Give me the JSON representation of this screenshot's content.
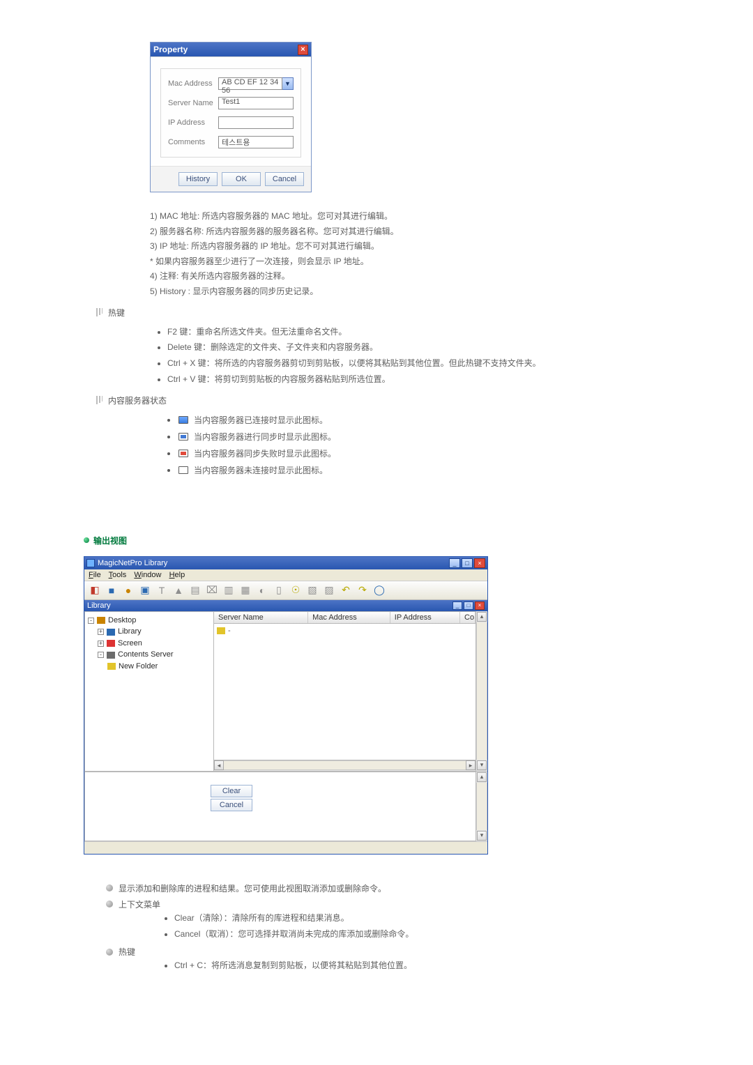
{
  "dialog": {
    "title": "Property",
    "close": "×",
    "fields": {
      "macLabel": "Mac Address",
      "macValue": "AB CD EF 12 34 56",
      "serverLabel": "Server Name",
      "serverValue": "Test1",
      "ipLabel": "IP Address",
      "ipValue": "",
      "commentsLabel": "Comments",
      "commentsValue": "테스트용"
    },
    "buttons": {
      "history": "History",
      "ok": "OK",
      "cancel": "Cancel"
    }
  },
  "propertyDesc": {
    "l1": "1) MAC 地址: 所选内容服务器的 MAC 地址。您可对其进行编辑。",
    "l2": "2) 服务器名称: 所选内容服务器的服务器名称。您可对其进行编辑。",
    "l3": "3) IP 地址: 所选内容服务器的 IP 地址。您不可对其进行编辑。",
    "l4": "* 如果内容服务器至少进行了一次连接，则会显示 IP 地址。",
    "l5": "4) 注释: 有关所选内容服务器的注释。",
    "l6": "5) History : 显示内容服务器的同步历史记录。"
  },
  "hotkeys": {
    "heading": "热键",
    "b1": "F2 键：重命名所选文件夹。但无法重命名文件。",
    "b2": "Delete 键：删除选定的文件夹、子文件夹和内容服务器。",
    "b3": "Ctrl + X 键：将所选的内容服务器剪切到剪贴板，以便将其粘贴到其他位置。但此热键不支持文件夹。",
    "b4": "Ctrl + V 键：将剪切到剪贴板的内容服务器粘贴到所选位置。"
  },
  "status": {
    "heading": "内容服务器状态",
    "s1": "当内容服务器已连接时显示此图标。",
    "s2": "当内容服务器进行同步时显示此图标。",
    "s3": "当内容服务器同步失败时显示此图标。",
    "s4": "当内容服务器未连接时显示此图标。"
  },
  "section": {
    "outputView": "输出视图"
  },
  "app": {
    "title": "MagicNetPro Library",
    "menu": {
      "file": "File",
      "tools": "Tools",
      "window": "Window",
      "help": "Help"
    },
    "panes": {
      "library": "Library"
    },
    "columns": {
      "serverName": "Server Name",
      "macAddress": "Mac Address",
      "ipAddress": "IP Address",
      "co": "Co"
    },
    "tree": {
      "desktop": "Desktop",
      "library": "Library",
      "screen": "Screen",
      "contentsServer": "Contents Server",
      "newFolder": "New Folder"
    },
    "entry": {
      "dash": "-"
    },
    "buttons": {
      "clear": "Clear",
      "cancel": "Cancel"
    },
    "winBtns": {
      "min": "_",
      "max": "□",
      "close": "×"
    }
  },
  "outputDesc": {
    "l1": "显示添加和删除库的进程和结果。您可使用此视图取消添加或删除命令。",
    "contextMenu": "上下文菜单",
    "c1": "Clear（清除）：清除所有的库进程和结果消息。",
    "c2": "Cancel（取消）：您可选择并取消尚未完成的库添加或删除命令。",
    "hotkey": "热键",
    "h1": "Ctrl + C：将所选消息复制到剪贴板，以便将其粘贴到其他位置。"
  }
}
